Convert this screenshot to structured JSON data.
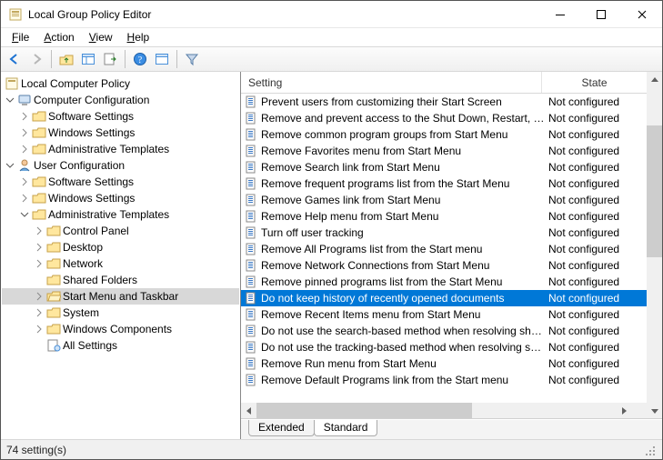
{
  "window": {
    "title": "Local Group Policy Editor"
  },
  "menu": {
    "file": "File",
    "action": "Action",
    "view": "View",
    "help": "Help"
  },
  "toolbar_icons": [
    "back",
    "forward",
    "up-folder",
    "tree-toggle",
    "export",
    "help",
    "properties",
    "filter"
  ],
  "tree": {
    "root": "Local Computer Policy",
    "computer": {
      "label": "Computer Configuration",
      "children": [
        {
          "label": "Software Settings"
        },
        {
          "label": "Windows Settings"
        },
        {
          "label": "Administrative Templates"
        }
      ]
    },
    "user": {
      "label": "User Configuration",
      "children": [
        {
          "label": "Software Settings"
        },
        {
          "label": "Windows Settings"
        }
      ],
      "admin": {
        "label": "Administrative Templates",
        "children": [
          {
            "label": "Control Panel"
          },
          {
            "label": "Desktop"
          },
          {
            "label": "Network"
          },
          {
            "label": "Shared Folders"
          },
          {
            "label": "Start Menu and Taskbar",
            "selected": true
          },
          {
            "label": "System"
          },
          {
            "label": "Windows Components"
          },
          {
            "label": "All Settings"
          }
        ]
      }
    }
  },
  "list": {
    "headers": {
      "setting": "Setting",
      "state": "State"
    },
    "rows": [
      {
        "label": "Prevent users from customizing their Start Screen",
        "state": "Not configured"
      },
      {
        "label": "Remove and prevent access to the Shut Down, Restart, Sleep...",
        "state": "Not configured"
      },
      {
        "label": "Remove common program groups from Start Menu",
        "state": "Not configured"
      },
      {
        "label": "Remove Favorites menu from Start Menu",
        "state": "Not configured"
      },
      {
        "label": "Remove Search link from Start Menu",
        "state": "Not configured"
      },
      {
        "label": "Remove frequent programs list from the Start Menu",
        "state": "Not configured"
      },
      {
        "label": "Remove Games link from Start Menu",
        "state": "Not configured"
      },
      {
        "label": "Remove Help menu from Start Menu",
        "state": "Not configured"
      },
      {
        "label": "Turn off user tracking",
        "state": "Not configured"
      },
      {
        "label": "Remove All Programs list from the Start menu",
        "state": "Not configured"
      },
      {
        "label": "Remove Network Connections from Start Menu",
        "state": "Not configured"
      },
      {
        "label": "Remove pinned programs list from the Start Menu",
        "state": "Not configured"
      },
      {
        "label": "Do not keep history of recently opened documents",
        "state": "Not configured",
        "selected": true
      },
      {
        "label": "Remove Recent Items menu from Start Menu",
        "state": "Not configured"
      },
      {
        "label": "Do not use the search-based method when resolving shell s...",
        "state": "Not configured"
      },
      {
        "label": "Do not use the tracking-based method when resolving shell ...",
        "state": "Not configured"
      },
      {
        "label": "Remove Run menu from Start Menu",
        "state": "Not configured"
      },
      {
        "label": "Remove Default Programs link from the Start menu",
        "state": "Not configured"
      }
    ]
  },
  "tabs": {
    "extended": "Extended",
    "standard": "Standard"
  },
  "status": {
    "text": "74 setting(s)"
  }
}
